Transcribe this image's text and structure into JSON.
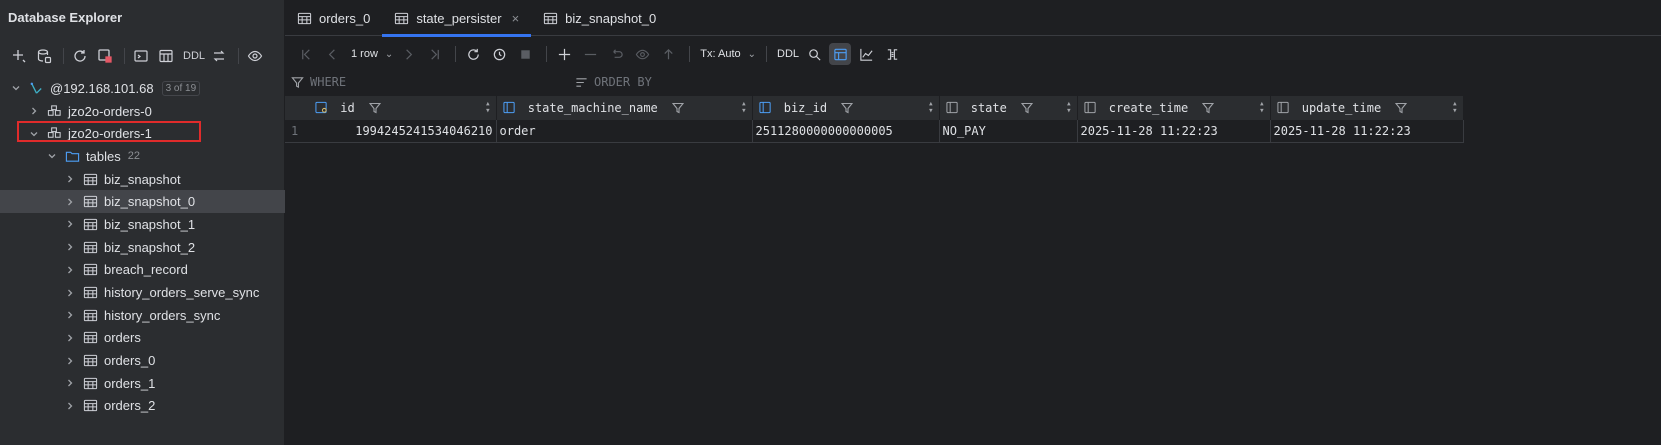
{
  "explorer": {
    "title": "Database Explorer",
    "toolbar": {
      "ddl_label": "DDL"
    },
    "tree": [
      {
        "label": "@192.168.101.68",
        "badge": "3 of 19",
        "icon": "datasource-icon",
        "expanded": true
      },
      {
        "label": "jzo2o-orders-0",
        "icon": "schema-icon",
        "expanded": false
      },
      {
        "label": "jzo2o-orders-1",
        "icon": "schema-icon",
        "expanded": true
      },
      {
        "label": "tables",
        "count": "22",
        "icon": "folder-icon",
        "expanded": true
      },
      {
        "label": "biz_snapshot",
        "icon": "table-icon"
      },
      {
        "label": "biz_snapshot_0",
        "icon": "table-icon",
        "selected": true
      },
      {
        "label": "biz_snapshot_1",
        "icon": "table-icon"
      },
      {
        "label": "biz_snapshot_2",
        "icon": "table-icon"
      },
      {
        "label": "breach_record",
        "icon": "table-icon"
      },
      {
        "label": "history_orders_serve_sync",
        "icon": "table-icon"
      },
      {
        "label": "history_orders_sync",
        "icon": "table-icon"
      },
      {
        "label": "orders",
        "icon": "table-icon"
      },
      {
        "label": "orders_0",
        "icon": "table-icon"
      },
      {
        "label": "orders_1",
        "icon": "table-icon"
      },
      {
        "label": "orders_2",
        "icon": "table-icon"
      }
    ]
  },
  "tabs": [
    {
      "label": "orders_0",
      "active": false
    },
    {
      "label": "state_persister",
      "active": true,
      "close": "×"
    },
    {
      "label": "biz_snapshot_0",
      "active": false
    }
  ],
  "grid_toolbar": {
    "rows_label": "1 row",
    "tx_label": "Tx: Auto",
    "ddl_label": "DDL"
  },
  "filter": {
    "where": "WHERE",
    "order_by": "ORDER BY"
  },
  "table": {
    "columns": [
      "id",
      "state_machine_name",
      "biz_id",
      "state",
      "create_time",
      "update_time"
    ],
    "rows": [
      {
        "num": "1",
        "cells": [
          "1994245241534046210",
          "order",
          "2511280000000000005",
          "NO_PAY",
          "2025-11-28 11:22:23",
          "2025-11-28 11:22:23"
        ]
      }
    ]
  },
  "colors": {
    "background": "#1e1f22",
    "panel": "#2b2d30",
    "accent": "#3574f0",
    "highlight_box": "#e02b2b"
  }
}
